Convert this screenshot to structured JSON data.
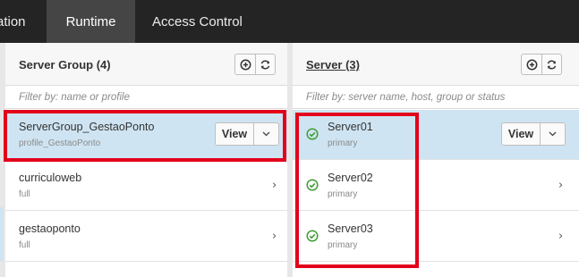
{
  "topnav": {
    "tabs": [
      {
        "label": "ation"
      },
      {
        "label": "Runtime"
      },
      {
        "label": "Access Control"
      }
    ]
  },
  "server_groups": {
    "title": "Server Group (4)",
    "filter_placeholder": "Filter by: name or profile",
    "items": [
      {
        "name": "ServerGroup_GestaoPonto",
        "profile": "profile_GestaoPonto"
      },
      {
        "name": "curriculoweb",
        "profile": "full"
      },
      {
        "name": "gestaoponto",
        "profile": "full"
      }
    ]
  },
  "servers": {
    "title": "Server (3)",
    "filter_placeholder": "Filter by: server name, host, group or status",
    "items": [
      {
        "name": "Server01",
        "role": "primary"
      },
      {
        "name": "Server02",
        "role": "primary"
      },
      {
        "name": "Server03",
        "role": "primary"
      }
    ]
  },
  "actions": {
    "view_label": "View"
  },
  "colors": {
    "topbar": "#242424",
    "active_tab": "#454545",
    "selected_row": "#cfe4f2",
    "status_ok": "#3f9c35",
    "highlight": "#e3001b"
  },
  "icons": {
    "add": "plus-circle-icon",
    "refresh": "refresh-icon",
    "status": "check-circle-icon",
    "caret": "chevron-down-icon",
    "next": "chevron-right-icon"
  }
}
